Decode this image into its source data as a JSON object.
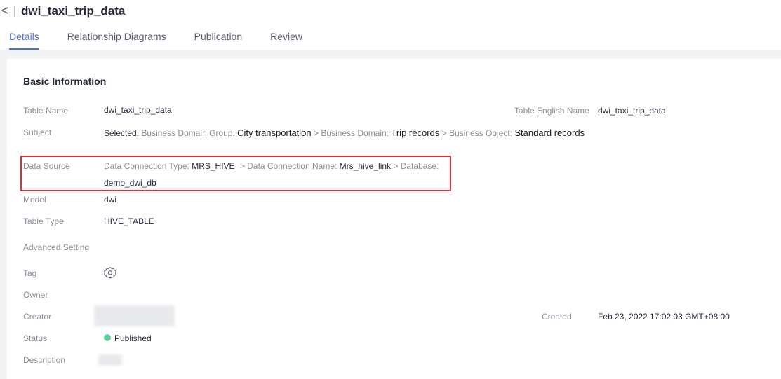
{
  "header": {
    "back_glyph": "<",
    "title": "dwi_taxi_trip_data"
  },
  "tabs": [
    {
      "label": "Details",
      "active": true
    },
    {
      "label": "Relationship Diagrams",
      "active": false
    },
    {
      "label": "Publication",
      "active": false
    },
    {
      "label": "Review",
      "active": false
    }
  ],
  "basic_info": {
    "section_title": "Basic Information",
    "table_name": {
      "label": "Table Name",
      "value": "dwi_taxi_trip_data"
    },
    "table_english_name": {
      "label": "Table English Name",
      "value": "dwi_taxi_trip_data"
    },
    "subject": {
      "label": "Subject",
      "selected_prefix": "Selected:",
      "group_label": "Business Domain Group:",
      "group_value": "City transportation",
      "domain_label": "> Business Domain:",
      "domain_value": "Trip records",
      "object_label": "> Business Object:",
      "object_value": "Standard records"
    },
    "data_source": {
      "label": "Data Source",
      "conn_type_label": "Data Connection Type:",
      "conn_type_value": "MRS_HIVE",
      "conn_name_label": "> Data Connection Name:",
      "conn_name_value": "Mrs_hive_link",
      "database_label": "> Database:",
      "database_value": "demo_dwi_db"
    },
    "model": {
      "label": "Model",
      "value": "dwi"
    },
    "table_type": {
      "label": "Table Type",
      "value": "HIVE_TABLE"
    },
    "advanced_setting": {
      "label": "Advanced Setting"
    },
    "tag": {
      "label": "Tag",
      "icon": "gear-icon"
    },
    "owner": {
      "label": "Owner"
    },
    "creator": {
      "label": "Creator"
    },
    "created": {
      "label": "Created",
      "value": "Feb 23, 2022 17:02:03 GMT+08:00"
    },
    "status": {
      "label": "Status",
      "value": "Published",
      "color": "#5fcfa0"
    },
    "description": {
      "label": "Description"
    }
  },
  "colors": {
    "accent": "#526ecc",
    "highlight_border": "#e0312d",
    "published": "#5fcfa0"
  }
}
